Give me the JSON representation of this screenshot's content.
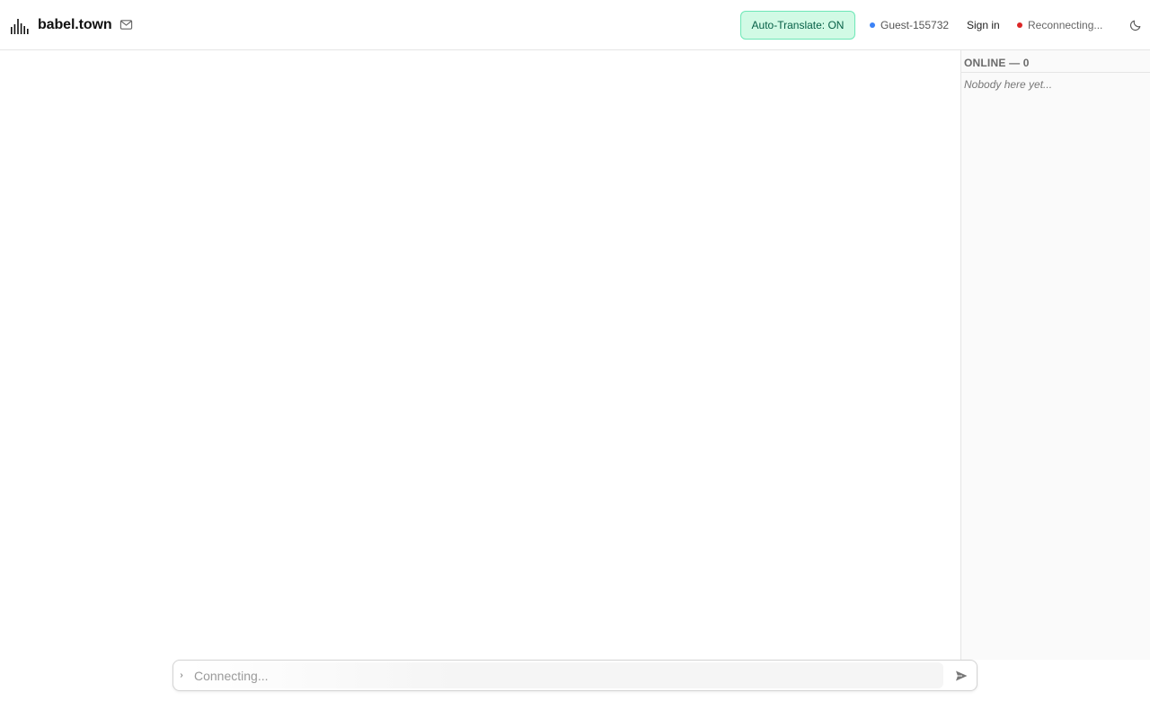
{
  "header": {
    "brand_name": "babel.town",
    "auto_translate_label": "Auto-Translate: ON",
    "guest_name": "Guest-155732",
    "sign_in_label": "Sign in",
    "connection_status": "Reconnecting...",
    "icons": {
      "logo": "waveform-bars-icon",
      "mail": "mail-icon",
      "theme": "moon-icon"
    },
    "colors": {
      "translate_bg": "#d1fae5",
      "translate_border": "#6ee7b7",
      "translate_text": "#065f46",
      "guest_dot": "#3b82f6",
      "status_dot": "#dc2626"
    }
  },
  "sidebar": {
    "online_label": "ONLINE — 0",
    "empty_text": "Nobody here yet..."
  },
  "composer": {
    "placeholder": "Connecting...",
    "prompt_glyph": "›",
    "send_icon": "send-icon"
  }
}
